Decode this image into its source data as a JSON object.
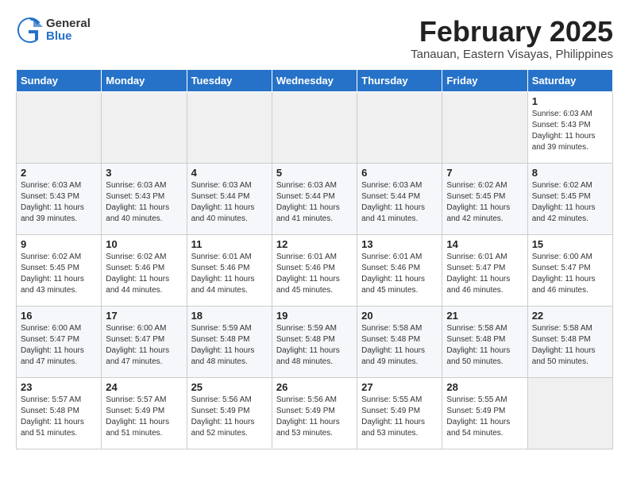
{
  "header": {
    "logo_line1": "General",
    "logo_line2": "Blue",
    "title": "February 2025",
    "subtitle": "Tanauan, Eastern Visayas, Philippines"
  },
  "days_of_week": [
    "Sunday",
    "Monday",
    "Tuesday",
    "Wednesday",
    "Thursday",
    "Friday",
    "Saturday"
  ],
  "weeks": [
    [
      {
        "day": "",
        "info": ""
      },
      {
        "day": "",
        "info": ""
      },
      {
        "day": "",
        "info": ""
      },
      {
        "day": "",
        "info": ""
      },
      {
        "day": "",
        "info": ""
      },
      {
        "day": "",
        "info": ""
      },
      {
        "day": "1",
        "info": "Sunrise: 6:03 AM\nSunset: 5:43 PM\nDaylight: 11 hours\nand 39 minutes."
      }
    ],
    [
      {
        "day": "2",
        "info": "Sunrise: 6:03 AM\nSunset: 5:43 PM\nDaylight: 11 hours\nand 39 minutes."
      },
      {
        "day": "3",
        "info": "Sunrise: 6:03 AM\nSunset: 5:43 PM\nDaylight: 11 hours\nand 40 minutes."
      },
      {
        "day": "4",
        "info": "Sunrise: 6:03 AM\nSunset: 5:44 PM\nDaylight: 11 hours\nand 40 minutes."
      },
      {
        "day": "5",
        "info": "Sunrise: 6:03 AM\nSunset: 5:44 PM\nDaylight: 11 hours\nand 41 minutes."
      },
      {
        "day": "6",
        "info": "Sunrise: 6:03 AM\nSunset: 5:44 PM\nDaylight: 11 hours\nand 41 minutes."
      },
      {
        "day": "7",
        "info": "Sunrise: 6:02 AM\nSunset: 5:45 PM\nDaylight: 11 hours\nand 42 minutes."
      },
      {
        "day": "8",
        "info": "Sunrise: 6:02 AM\nSunset: 5:45 PM\nDaylight: 11 hours\nand 42 minutes."
      }
    ],
    [
      {
        "day": "9",
        "info": "Sunrise: 6:02 AM\nSunset: 5:45 PM\nDaylight: 11 hours\nand 43 minutes."
      },
      {
        "day": "10",
        "info": "Sunrise: 6:02 AM\nSunset: 5:46 PM\nDaylight: 11 hours\nand 44 minutes."
      },
      {
        "day": "11",
        "info": "Sunrise: 6:01 AM\nSunset: 5:46 PM\nDaylight: 11 hours\nand 44 minutes."
      },
      {
        "day": "12",
        "info": "Sunrise: 6:01 AM\nSunset: 5:46 PM\nDaylight: 11 hours\nand 45 minutes."
      },
      {
        "day": "13",
        "info": "Sunrise: 6:01 AM\nSunset: 5:46 PM\nDaylight: 11 hours\nand 45 minutes."
      },
      {
        "day": "14",
        "info": "Sunrise: 6:01 AM\nSunset: 5:47 PM\nDaylight: 11 hours\nand 46 minutes."
      },
      {
        "day": "15",
        "info": "Sunrise: 6:00 AM\nSunset: 5:47 PM\nDaylight: 11 hours\nand 46 minutes."
      }
    ],
    [
      {
        "day": "16",
        "info": "Sunrise: 6:00 AM\nSunset: 5:47 PM\nDaylight: 11 hours\nand 47 minutes."
      },
      {
        "day": "17",
        "info": "Sunrise: 6:00 AM\nSunset: 5:47 PM\nDaylight: 11 hours\nand 47 minutes."
      },
      {
        "day": "18",
        "info": "Sunrise: 5:59 AM\nSunset: 5:48 PM\nDaylight: 11 hours\nand 48 minutes."
      },
      {
        "day": "19",
        "info": "Sunrise: 5:59 AM\nSunset: 5:48 PM\nDaylight: 11 hours\nand 48 minutes."
      },
      {
        "day": "20",
        "info": "Sunrise: 5:58 AM\nSunset: 5:48 PM\nDaylight: 11 hours\nand 49 minutes."
      },
      {
        "day": "21",
        "info": "Sunrise: 5:58 AM\nSunset: 5:48 PM\nDaylight: 11 hours\nand 50 minutes."
      },
      {
        "day": "22",
        "info": "Sunrise: 5:58 AM\nSunset: 5:48 PM\nDaylight: 11 hours\nand 50 minutes."
      }
    ],
    [
      {
        "day": "23",
        "info": "Sunrise: 5:57 AM\nSunset: 5:48 PM\nDaylight: 11 hours\nand 51 minutes."
      },
      {
        "day": "24",
        "info": "Sunrise: 5:57 AM\nSunset: 5:49 PM\nDaylight: 11 hours\nand 51 minutes."
      },
      {
        "day": "25",
        "info": "Sunrise: 5:56 AM\nSunset: 5:49 PM\nDaylight: 11 hours\nand 52 minutes."
      },
      {
        "day": "26",
        "info": "Sunrise: 5:56 AM\nSunset: 5:49 PM\nDaylight: 11 hours\nand 53 minutes."
      },
      {
        "day": "27",
        "info": "Sunrise: 5:55 AM\nSunset: 5:49 PM\nDaylight: 11 hours\nand 53 minutes."
      },
      {
        "day": "28",
        "info": "Sunrise: 5:55 AM\nSunset: 5:49 PM\nDaylight: 11 hours\nand 54 minutes."
      },
      {
        "day": "",
        "info": ""
      }
    ]
  ]
}
